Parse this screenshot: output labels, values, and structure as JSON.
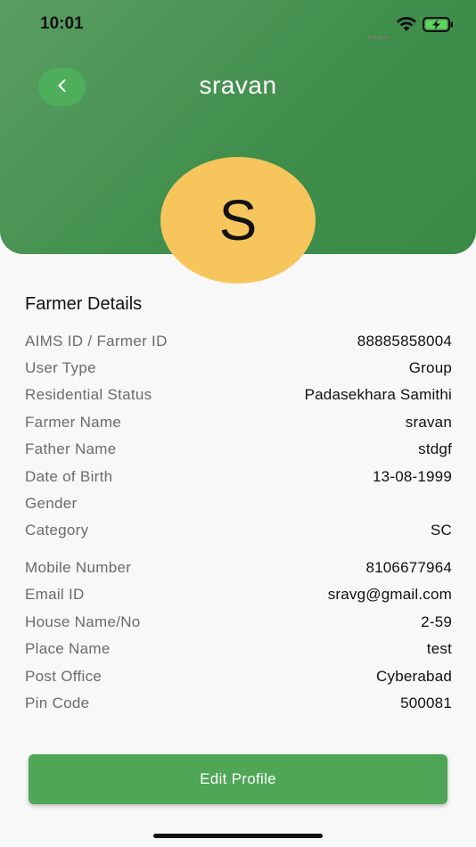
{
  "status_bar": {
    "time": "10:01"
  },
  "header": {
    "title": "sravan",
    "avatar_letter": "S"
  },
  "section": {
    "title": "Farmer Details"
  },
  "details": [
    {
      "label": "AIMS ID / Farmer ID",
      "value": "88885858004"
    },
    {
      "label": "User Type",
      "value": "Group"
    },
    {
      "label": "Residential Status",
      "value": "Padasekhara Samithi"
    },
    {
      "label": "Farmer Name",
      "value": "sravan"
    },
    {
      "label": "Father Name",
      "value": "stdgf"
    },
    {
      "label": "Date of Birth",
      "value": "13-08-1999"
    },
    {
      "label": "Gender",
      "value": ""
    },
    {
      "label": "Category",
      "value": "SC"
    },
    {
      "label": "Mobile Number",
      "value": "8106677964"
    },
    {
      "label": "Email ID",
      "value": "sravg@gmail.com"
    },
    {
      "label": "House Name/No",
      "value": "2-59"
    },
    {
      "label": "Place Name",
      "value": "test"
    },
    {
      "label": "Post Office",
      "value": "Cyberabad"
    },
    {
      "label": "Pin Code",
      "value": "500081"
    }
  ],
  "actions": {
    "edit_profile": "Edit Profile"
  },
  "icons": {
    "back": "chevron-left-icon",
    "wifi": "wifi-icon",
    "battery": "battery-charging-icon",
    "signal": "signal-icon"
  },
  "colors": {
    "header": "#3f8e4b",
    "back_button": "#4fae5b",
    "avatar": "#f6c65d",
    "primary_button": "#4fa657"
  }
}
